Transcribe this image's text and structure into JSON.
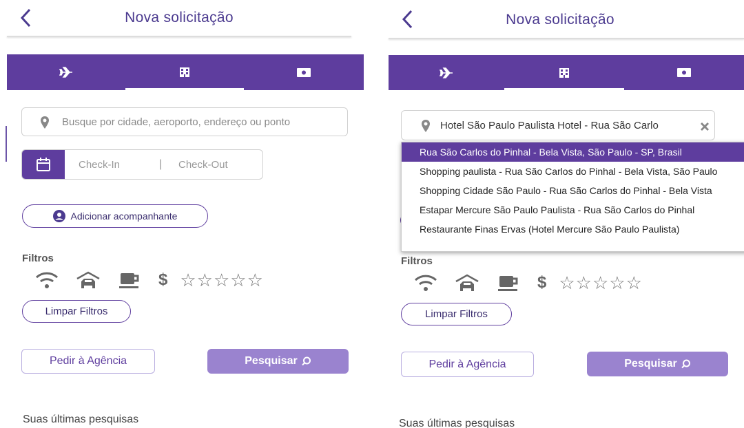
{
  "left": {
    "header": {
      "title": "Nova solicitação"
    },
    "search": {
      "placeholder": "Busque por cidade, aeroporto, endereço ou ponto"
    },
    "dates": {
      "checkin": "Check-In",
      "separator": "|",
      "checkout": "Check-Out"
    },
    "companion_label": "Adicionar acompanhante",
    "filters": {
      "label": "Filtros",
      "currency_symbol": "$",
      "stars": [
        "☆",
        "☆",
        "☆",
        "☆",
        "☆"
      ]
    },
    "clear_filters": "Limpar Filtros",
    "ask_agency": "Pedir à Agência",
    "search_button": "Pesquisar",
    "recent_title": "Suas últimas pesquisas"
  },
  "right": {
    "header": {
      "title": "Nova solicitação"
    },
    "search": {
      "value": "Hotel São Paulo Paulista Hotel - Rua São Carlo"
    },
    "suggestions": [
      {
        "label": "Rua São Carlos do Pinhal - Bela Vista, São Paulo - SP, Brasil",
        "selected": true
      },
      {
        "label": "Shopping paulista - Rua São Carlos do Pinhal - Bela Vista, São Paulo",
        "selected": false
      },
      {
        "label": "Shopping Cidade São Paulo - Rua São Carlos do Pinhal - Bela Vista",
        "selected": false
      },
      {
        "label": "Estapar Mercure São Paulo Paulista - Rua São Carlos do Pinhal",
        "selected": false
      },
      {
        "label": "Restaurante Finas Ervas (Hotel Mercure São Paulo Paulista)",
        "selected": false
      }
    ],
    "filters": {
      "label": "Filtros",
      "currency_symbol": "$",
      "stars": [
        "☆",
        "☆",
        "☆",
        "☆",
        "☆"
      ]
    },
    "clear_filters": "Limpar Filtros",
    "ask_agency": "Pedir à Agência",
    "search_button": "Pesquisar",
    "recent_title": "Suas últimas pesquisas"
  },
  "colors": {
    "brand": "#5e3d9e",
    "brand_light": "#9a83cf",
    "title": "#4b3a8f"
  },
  "icons": [
    "chevron-left-icon",
    "airplane-icon",
    "hotel-icon",
    "money-icon",
    "location-pin-icon",
    "calendar-icon",
    "user-circle-icon",
    "wifi-icon",
    "car-icon",
    "coffee-icon",
    "star-icon",
    "search-icon",
    "clear-x-icon"
  ]
}
